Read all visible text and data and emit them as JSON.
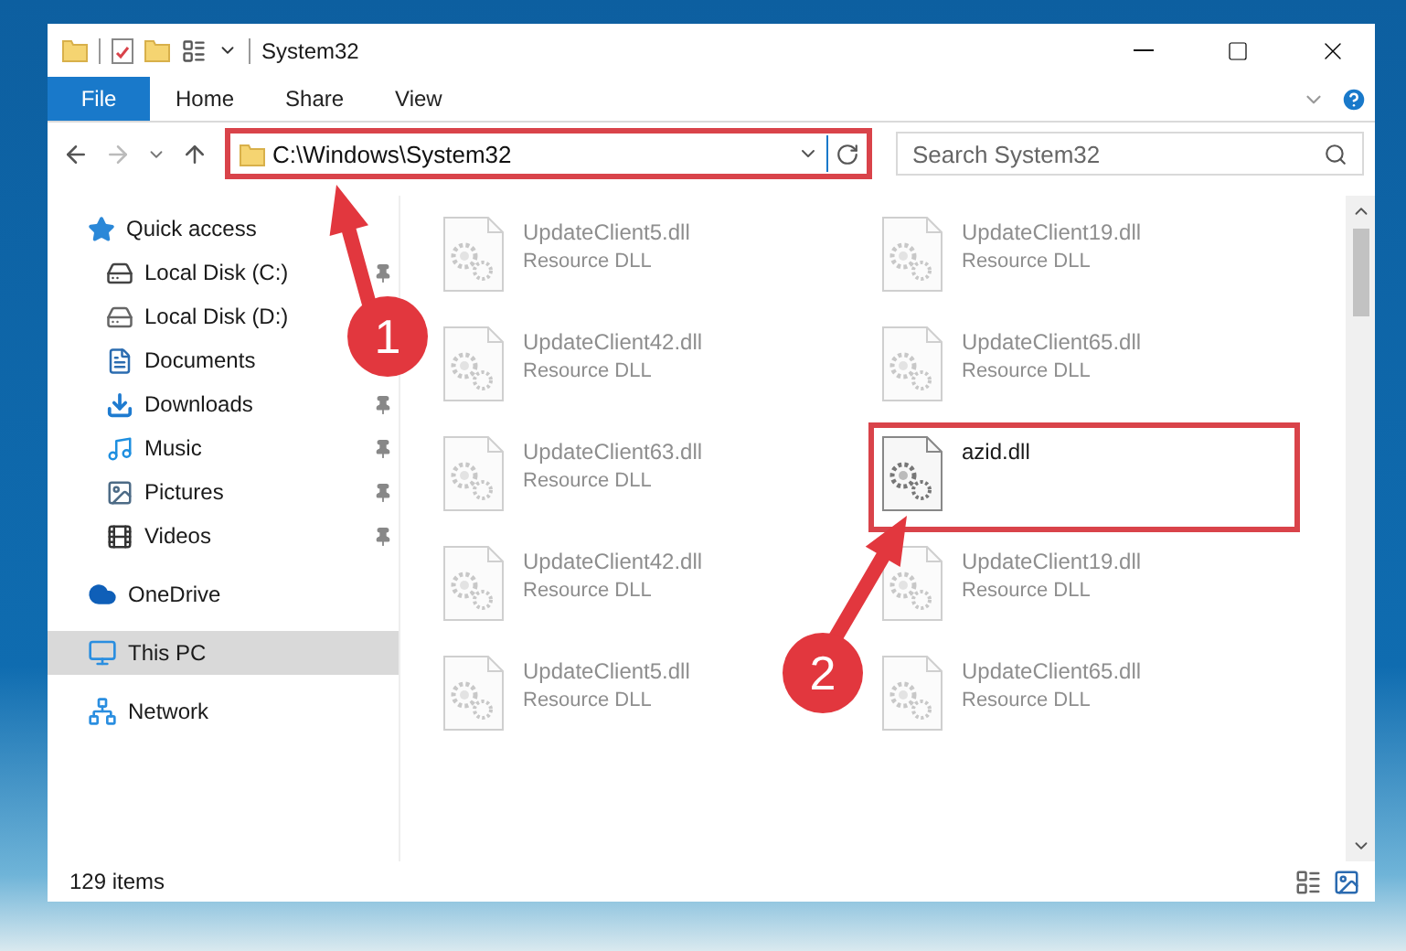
{
  "window": {
    "title": "System32"
  },
  "ribbon": {
    "file_button": "File",
    "tabs": [
      {
        "label": "Home",
        "selected": false
      },
      {
        "label": "Share",
        "selected": false
      },
      {
        "label": "View",
        "selected": false
      }
    ]
  },
  "address": {
    "path": "C:\\Windows\\System32"
  },
  "search": {
    "placeholder": "Search System32"
  },
  "navigation": [
    {
      "label": "Quick access",
      "kind": "star",
      "selected": false,
      "children": [
        {
          "label": "Local Disk (C:)",
          "kind": "windows-drive",
          "selected": false,
          "pinned": true
        },
        {
          "label": "Local Disk (D:)",
          "kind": "drive",
          "selected": false
        },
        {
          "label": "Documents",
          "kind": "documents",
          "selected": false
        },
        {
          "label": "Downloads",
          "kind": "downloads",
          "selected": false,
          "pinned": true
        },
        {
          "label": "Music",
          "kind": "music",
          "selected": false,
          "pinned": true
        },
        {
          "label": "Pictures",
          "kind": "pictures",
          "selected": false,
          "pinned": true
        },
        {
          "label": "Videos",
          "kind": "videos",
          "selected": false,
          "pinned": true
        }
      ]
    },
    {
      "label": "OneDrive",
      "kind": "cloud",
      "selected": false
    },
    {
      "label": "This PC",
      "kind": "pc",
      "selected": true
    },
    {
      "label": "Network",
      "kind": "network",
      "selected": false
    }
  ],
  "files": [
    {
      "name": "UpdateClient5.dll",
      "type": "Resource DLL",
      "dimmed": true,
      "highlighted": false
    },
    {
      "name": "UpdateClient19.dll",
      "type": "Resource DLL",
      "dimmed": true,
      "highlighted": false
    },
    {
      "name": "UpdateClient42.dll",
      "type": "Resource DLL",
      "dimmed": true,
      "highlighted": false
    },
    {
      "name": "UpdateClient65.dll",
      "type": "Resource DLL",
      "dimmed": true,
      "highlighted": false
    },
    {
      "name": "UpdateClient63.dll",
      "type": "Resource DLL",
      "dimmed": true,
      "highlighted": false
    },
    {
      "name": "azid.dll",
      "dimmed": false,
      "highlighted": true
    },
    {
      "name": "UpdateClient42.dll",
      "type": "Resource DLL",
      "dimmed": true,
      "highlighted": false
    },
    {
      "name": "UpdateClient19.dll",
      "type": "Resource DLL",
      "dimmed": true,
      "highlighted": false
    },
    {
      "name": "UpdateClient5.dll",
      "type": "Resource DLL",
      "dimmed": true,
      "highlighted": false
    },
    {
      "name": "UpdateClient65.dll",
      "type": "Resource DLL",
      "dimmed": true,
      "highlighted": false
    }
  ],
  "annotations": [
    {
      "number": "1"
    },
    {
      "number": "2"
    }
  ],
  "status_bar": {
    "count": "129 items"
  }
}
